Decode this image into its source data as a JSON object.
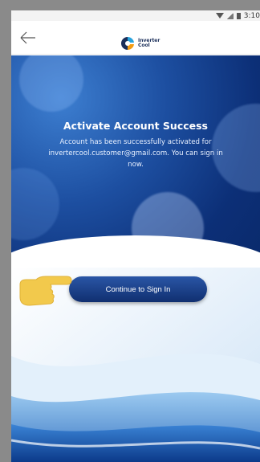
{
  "status_bar": {
    "time": "3:10"
  },
  "header": {
    "back_icon": "arrow-left-icon",
    "logo_line1": "Inverter",
    "logo_line2": "Cool"
  },
  "main": {
    "title": "Activate Account Success",
    "message": "Account has been successfully activated for invertercool.customer@gmail.com. You can sign in now.",
    "primary_button": "Continue to Sign In"
  },
  "colors": {
    "hero_dark": "#0c2f77",
    "hero_light": "#3d7fd1",
    "button_top": "#2a56a6",
    "button_bottom": "#102f70",
    "pointer_hand": "#f2c94c"
  }
}
